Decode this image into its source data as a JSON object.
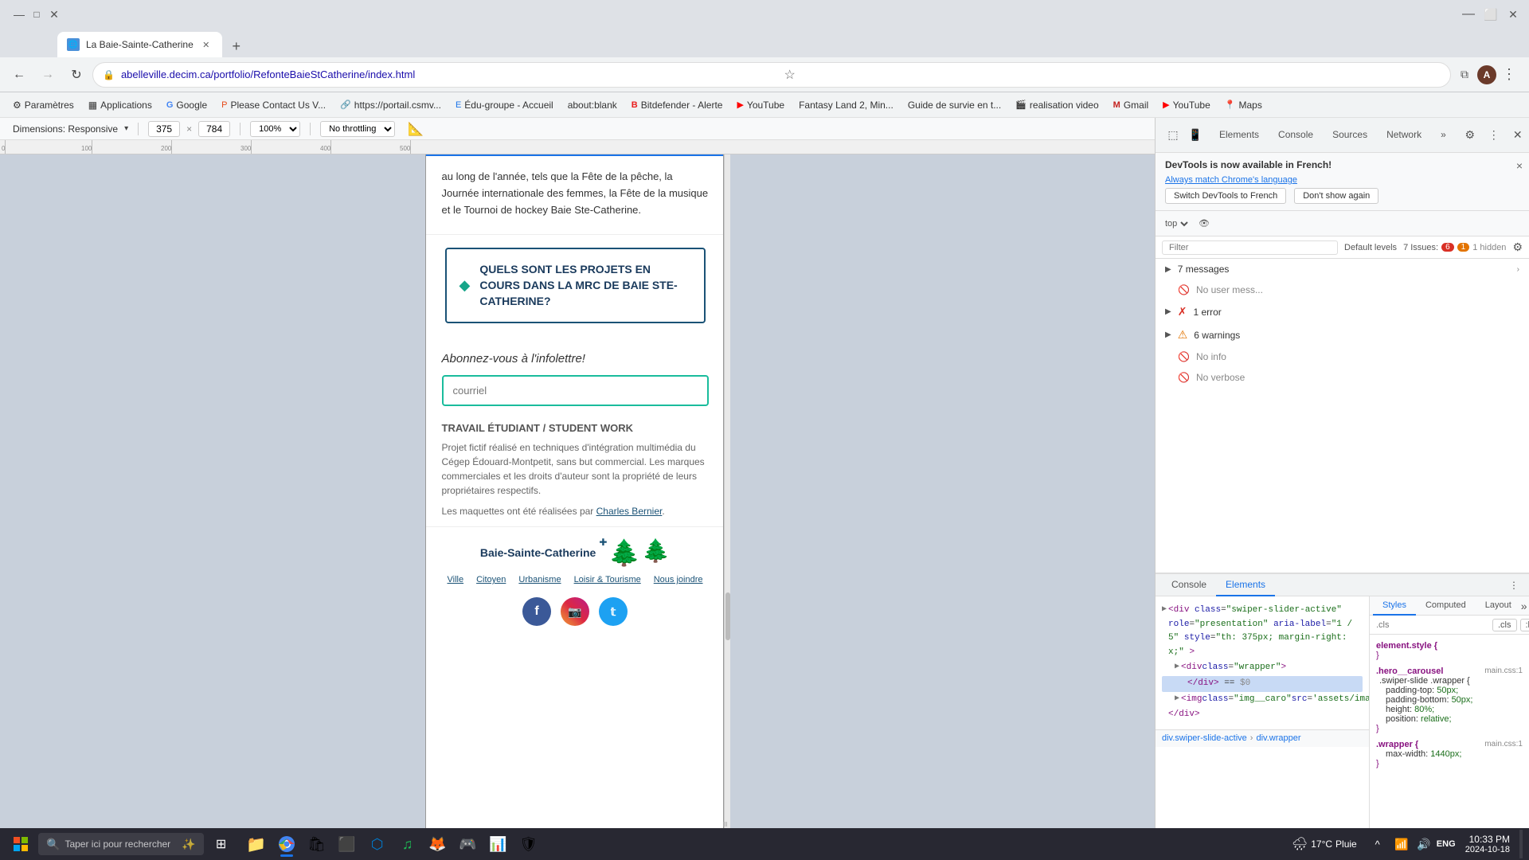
{
  "browser": {
    "tab": {
      "title": "La Baie-Sainte-Catherine",
      "favicon": "🌐"
    },
    "address": "abelleville.decim.ca/portfolio/RefonteBaieStCatherine/index.html",
    "new_tab_label": "+",
    "back_disabled": false,
    "forward_disabled": false
  },
  "bookmarks": [
    {
      "label": "Paramètres",
      "favicon": "⚙"
    },
    {
      "label": "Applications",
      "favicon": "▦"
    },
    {
      "label": "Google",
      "favicon": "G"
    },
    {
      "label": "Please Contact Us V...",
      "favicon": "P"
    },
    {
      "label": "https://portail.csmv...",
      "favicon": "🔗"
    },
    {
      "label": "Édu-groupe - Accueil",
      "favicon": "E"
    },
    {
      "label": "about:blank",
      "favicon": "•"
    },
    {
      "label": "Bitdefender - Alerte",
      "favicon": "B"
    },
    {
      "label": "YouTube",
      "favicon": "▶"
    },
    {
      "label": "Fantasy Land 2, Min...",
      "favicon": "F"
    },
    {
      "label": "Guide de survie en t...",
      "favicon": "G"
    },
    {
      "label": "realisation video",
      "favicon": "🎬"
    },
    {
      "label": "Gmail",
      "favicon": "M"
    },
    {
      "label": "YouTube",
      "favicon": "▶"
    },
    {
      "label": "Maps",
      "favicon": "📍"
    }
  ],
  "device_toolbar": {
    "device_label": "Dimensions: Responsive",
    "width": "375",
    "height": "784",
    "zoom": "100%",
    "throttle": "No throttling"
  },
  "page_content": {
    "text_block": "au long de l'année, tels que la Fête de la pêche, la Journée internationale des femmes, la Fête de la musique et le Tournoi de hockey Baie Ste-Catherine.",
    "accordion_title": "QUELS SONT LES PROJETS EN COURS DANS LA MRC DE BAIE STE-CATHERINE?",
    "newsletter_title": "Abonnez-vous à l'infolettre!",
    "newsletter_placeholder": "courriel",
    "student_work_title": "TRAVAIL ÉTUDIANT / STUDENT WORK",
    "student_work_text": "Projet fictif réalisé en techniques d'intégration multimédia du Cégep Édouard-Montpetit, sans but commercial. Les marques commerciales et les droits d'auteur sont la propriété de leurs propriétaires respectifs.",
    "student_work_credit": "Les maquettes ont été réalisées par ",
    "student_work_author": "Charles Bernier",
    "student_work_period": ".",
    "footer_site_name": "Baie-Sainte-Catherine",
    "footer_nav_items": [
      "Ville",
      "Citoyen",
      "Urbanisme",
      "Loisir & Tourisme",
      "Nous joindre"
    ],
    "social_icons": [
      "facebook",
      "instagram",
      "twitter"
    ]
  },
  "devtools": {
    "notification": {
      "title": "DevTools is now available in French!",
      "link_text": "Always match Chrome's language",
      "btn1": "Switch DevTools to French",
      "btn2": "Don't show again",
      "close": "×"
    },
    "toolbar_btns": [
      "⬚",
      "📱",
      "»",
      "🔴",
      "⏸",
      "⋮",
      "✕"
    ],
    "filter_placeholder": "Filter",
    "default_levels_label": "Default levels",
    "issues": {
      "label": "7 Issues:",
      "red_count": "6",
      "yellow_count": "1",
      "hidden_count": "1 hidden"
    },
    "sidebar_items": [
      {
        "label": "7 messages",
        "expandable": true,
        "icon": "▶"
      },
      {
        "label": "No user mess...",
        "icon": "🚫",
        "expandable": false
      },
      {
        "label": "1 error",
        "icon": "❌",
        "expandable": true
      },
      {
        "label": "6 warnings",
        "icon": "⚠",
        "expandable": true
      },
      {
        "label": "No info",
        "icon": "🚫",
        "expandable": false
      },
      {
        "label": "No verbose",
        "icon": "🚫",
        "expandable": false
      }
    ],
    "bottom_tabs": [
      "Console",
      "Elements"
    ],
    "active_bottom_tab": "Elements",
    "code_lines": [
      {
        "indent": 0,
        "text": "<div class=\"swiper-slider-active\" role=\"presentation\" aria-label=\"1 / 5\" style=\"th: 375px; margin-right: x;\">",
        "expanded": true
      },
      {
        "indent": 1,
        "text": "<div class=\"wrapper\">",
        "expanded": false
      },
      {
        "indent": 2,
        "text": "</div> == $0",
        "selected": true
      },
      {
        "indent": 1,
        "text": "<img class=\"img__caro src='assets/images/img alt=''>",
        "expanded": false
      },
      {
        "indent": 1,
        "text": "</div>",
        "expanded": false
      }
    ],
    "breadcrumb": [
      "div.swiper-slide-active",
      "div.wrapper"
    ],
    "styles_tab_label": "Styles",
    "computed_tab_label": "Computed",
    "layout_tab_label": "Layout",
    "styles": [
      {
        "selector": "element.style {",
        "source": "",
        "props": []
      },
      {
        "selector": ".hero__carousel",
        "source": "main.css:1",
        "props": [
          {
            "prop": ".swiper-slide .wrapper {",
            "val": ""
          },
          {
            "prop": "padding-top:",
            "val": "50px;"
          },
          {
            "prop": "padding-bottom:",
            "val": "50px;"
          },
          {
            "prop": "height:",
            "val": "80%;"
          },
          {
            "prop": "position:",
            "val": "relative;"
          }
        ]
      },
      {
        "selector": ".wrapper {",
        "source": "main.css:1",
        "props": [
          {
            "prop": "max-width:",
            "val": "1440px;"
          }
        ]
      }
    ],
    "filter_styles_placeholder": ".cls",
    "filter_styles_btns": [
      "+",
      ".cls",
      ":hov"
    ]
  },
  "taskbar": {
    "search_placeholder": "Taper ici pour rechercher",
    "clock": {
      "time": "10:33 PM",
      "date": "2024-10-18"
    },
    "weather": {
      "temp": "17°C",
      "condition": "Pluie"
    },
    "language": "ENG"
  }
}
